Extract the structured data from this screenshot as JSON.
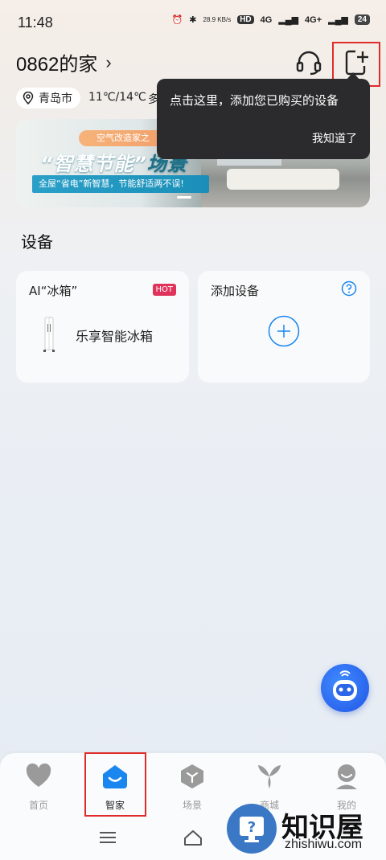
{
  "status_bar": {
    "time": "11:48",
    "net_speed": "28.9 KB/s",
    "sim1": "HD",
    "net1": "4G",
    "net2": "4G+",
    "battery": "24"
  },
  "header": {
    "home_name": "0862的家",
    "chevron": "›",
    "support_icon": "headset-icon",
    "add_icon": "add-device-icon"
  },
  "location": {
    "city": "青岛市",
    "temperature": "11℃/14℃",
    "weather_partial": "多"
  },
  "tooltip": {
    "text": "点击这里，添加您已购买的设备",
    "button": "我知道了"
  },
  "banner": {
    "tag": "空气改造家之",
    "title_1": "“智慧节能”",
    "title_2": "场景",
    "subtitle": "全屋“省电”新智慧，节能舒适两不误!"
  },
  "devices_section": {
    "title": "设备",
    "fridge_card": {
      "label": "AI“冰箱”",
      "badge": "HOT",
      "name": "乐享智能冰箱"
    },
    "add_card": {
      "label": "添加设备"
    }
  },
  "bottom_nav": {
    "items": [
      {
        "label": "首页",
        "icon": "heart-icon"
      },
      {
        "label": "智家",
        "icon": "smart-home-icon"
      },
      {
        "label": "场景",
        "icon": "cube-icon"
      },
      {
        "label": "商城",
        "icon": "propeller-icon"
      },
      {
        "label": "我的",
        "icon": "user-icon"
      }
    ],
    "active_index": 1
  },
  "watermark": {
    "title": "知识屋",
    "url": "zhishiwu.com"
  },
  "colors": {
    "accent": "#1a86f0",
    "highlight": "#e02b2b",
    "hot": "#e0335b"
  }
}
